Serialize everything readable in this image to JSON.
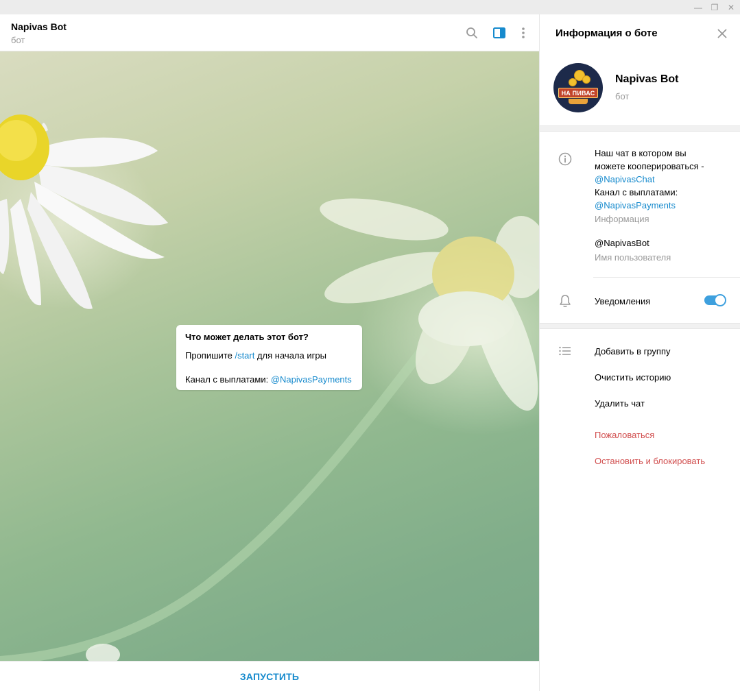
{
  "window": {
    "minimize_glyph": "—",
    "maximize_glyph": "❐",
    "close_glyph": "✕"
  },
  "chat": {
    "title": "Napivas Bot",
    "subtitle": "бот",
    "icons": [
      "search-icon",
      "side-panel-icon",
      "more-vertical-icon"
    ],
    "info_bubble": {
      "title": "Что может делать этот бот?",
      "line1_prefix": "Пропишите ",
      "line1_link": "/start",
      "line1_suffix": " для начала игры",
      "line2_prefix": "Канал с выплатами: ",
      "line2_link": "@NapivasPayments"
    },
    "start_button": "ЗАПУСТИТЬ"
  },
  "panel": {
    "title": "Информация о боте",
    "avatar_text": "НА ПИВАС",
    "bot_name": "Napivas Bot",
    "bot_subtitle": "бот",
    "description": {
      "line1": "Наш чат в котором вы",
      "line2": "можете кооперироваться -",
      "link1": "@NapivasChat",
      "line3": "Канал с выплатами:",
      "link2": "@NapivasPayments",
      "label": "Информация"
    },
    "username": "@NapivasBot",
    "username_label": "Имя пользователя",
    "notifications_label": "Уведомления",
    "notifications_on": true,
    "actions": {
      "add_to_group": "Добавить в группу",
      "clear_history": "Очистить историю",
      "delete_chat": "Удалить чат",
      "report": "Пожаловаться",
      "stop_and_block": "Остановить и блокировать"
    }
  },
  "colors": {
    "accent": "#168acd",
    "toggle": "#3ea0de",
    "danger": "#d14e4e",
    "muted": "#999999"
  }
}
